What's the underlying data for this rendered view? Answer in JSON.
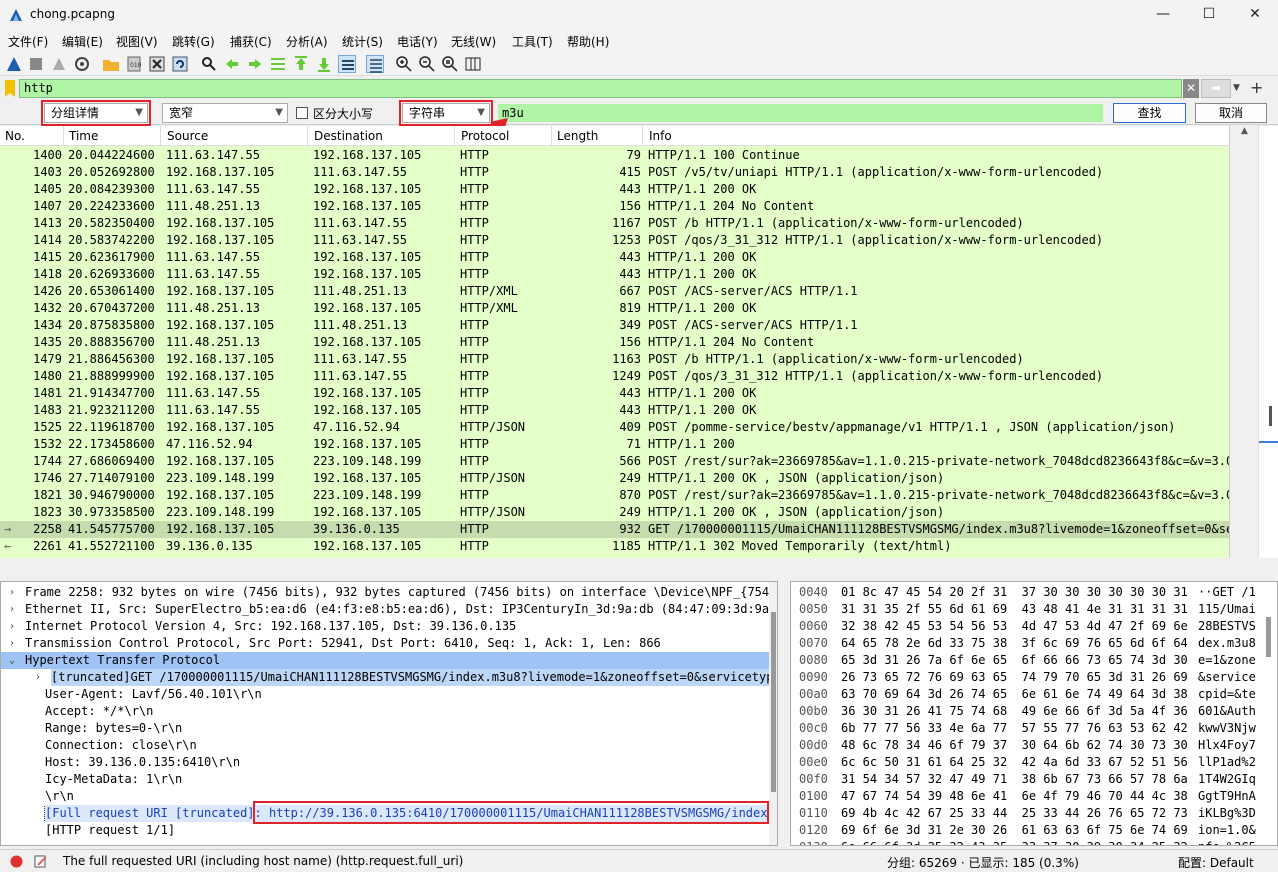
{
  "window": {
    "title": "chong.pcapng"
  },
  "menu": [
    "文件(F)",
    "编辑(E)",
    "视图(V)",
    "跳转(G)",
    "捕获(C)",
    "分析(A)",
    "统计(S)",
    "电话(Y)",
    "无线(W)",
    "工具(T)",
    "帮助(H)"
  ],
  "filter": {
    "value": "http"
  },
  "find": {
    "search_in": "分组详情",
    "charset": "宽窄",
    "case_label": "区分大小写",
    "search_type": "字符串",
    "search_value": "m3u",
    "find_button": "查找",
    "cancel_button": "取消"
  },
  "columns": [
    "No.",
    "Time",
    "Source",
    "Destination",
    "Protocol",
    "Length",
    "Info"
  ],
  "packets": [
    {
      "no": "1400",
      "time": "20.044224600",
      "src": "111.63.147.55",
      "dst": "192.168.137.105",
      "proto": "HTTP",
      "len": "79",
      "info": "HTTP/1.1 100 Continue"
    },
    {
      "no": "1403",
      "time": "20.052692800",
      "src": "192.168.137.105",
      "dst": "111.63.147.55",
      "proto": "HTTP",
      "len": "415",
      "info": "POST /v5/tv/uniapi HTTP/1.1  (application/x-www-form-urlencoded)"
    },
    {
      "no": "1405",
      "time": "20.084239300",
      "src": "111.63.147.55",
      "dst": "192.168.137.105",
      "proto": "HTTP",
      "len": "443",
      "info": "HTTP/1.1 200 OK"
    },
    {
      "no": "1407",
      "time": "20.224233600",
      "src": "111.48.251.13",
      "dst": "192.168.137.105",
      "proto": "HTTP",
      "len": "156",
      "info": "HTTP/1.1 204 No Content"
    },
    {
      "no": "1413",
      "time": "20.582350400",
      "src": "192.168.137.105",
      "dst": "111.63.147.55",
      "proto": "HTTP",
      "len": "1167",
      "info": "POST /b HTTP/1.1  (application/x-www-form-urlencoded)"
    },
    {
      "no": "1414",
      "time": "20.583742200",
      "src": "192.168.137.105",
      "dst": "111.63.147.55",
      "proto": "HTTP",
      "len": "1253",
      "info": "POST /qos/3_31_312 HTTP/1.1  (application/x-www-form-urlencoded)"
    },
    {
      "no": "1415",
      "time": "20.623617900",
      "src": "111.63.147.55",
      "dst": "192.168.137.105",
      "proto": "HTTP",
      "len": "443",
      "info": "HTTP/1.1 200 OK"
    },
    {
      "no": "1418",
      "time": "20.626933600",
      "src": "111.63.147.55",
      "dst": "192.168.137.105",
      "proto": "HTTP",
      "len": "443",
      "info": "HTTP/1.1 200 OK"
    },
    {
      "no": "1426",
      "time": "20.653061400",
      "src": "192.168.137.105",
      "dst": "111.48.251.13",
      "proto": "HTTP/XML",
      "len": "667",
      "info": "POST /ACS-server/ACS HTTP/1.1"
    },
    {
      "no": "1432",
      "time": "20.670437200",
      "src": "111.48.251.13",
      "dst": "192.168.137.105",
      "proto": "HTTP/XML",
      "len": "819",
      "info": "HTTP/1.1 200 OK"
    },
    {
      "no": "1434",
      "time": "20.875835800",
      "src": "192.168.137.105",
      "dst": "111.48.251.13",
      "proto": "HTTP",
      "len": "349",
      "info": "POST /ACS-server/ACS HTTP/1.1"
    },
    {
      "no": "1435",
      "time": "20.888356700",
      "src": "111.48.251.13",
      "dst": "192.168.137.105",
      "proto": "HTTP",
      "len": "156",
      "info": "HTTP/1.1 204 No Content"
    },
    {
      "no": "1479",
      "time": "21.886456300",
      "src": "192.168.137.105",
      "dst": "111.63.147.55",
      "proto": "HTTP",
      "len": "1163",
      "info": "POST /b HTTP/1.1  (application/x-www-form-urlencoded)"
    },
    {
      "no": "1480",
      "time": "21.888999900",
      "src": "192.168.137.105",
      "dst": "111.63.147.55",
      "proto": "HTTP",
      "len": "1249",
      "info": "POST /qos/3_31_312 HTTP/1.1  (application/x-www-form-urlencoded)"
    },
    {
      "no": "1481",
      "time": "21.914347700",
      "src": "111.63.147.55",
      "dst": "192.168.137.105",
      "proto": "HTTP",
      "len": "443",
      "info": "HTTP/1.1 200 OK"
    },
    {
      "no": "1483",
      "time": "21.923211200",
      "src": "111.63.147.55",
      "dst": "192.168.137.105",
      "proto": "HTTP",
      "len": "443",
      "info": "HTTP/1.1 200 OK"
    },
    {
      "no": "1525",
      "time": "22.119618700",
      "src": "192.168.137.105",
      "dst": "47.116.52.94",
      "proto": "HTTP/JSON",
      "len": "409",
      "info": "POST /pomme-service/bestv/appmanage/v1 HTTP/1.1 , JSON (application/json)"
    },
    {
      "no": "1532",
      "time": "22.173458600",
      "src": "47.116.52.94",
      "dst": "192.168.137.105",
      "proto": "HTTP",
      "len": "71",
      "info": "HTTP/1.1 200"
    },
    {
      "no": "1744",
      "time": "27.686069400",
      "src": "192.168.137.105",
      "dst": "223.109.148.199",
      "proto": "HTTP",
      "len": "566",
      "info": "POST /rest/sur?ak=23669785&av=1.1.0.215-private-network_7048dcd8236643f8&c=&v=3.0&s"
    },
    {
      "no": "1746",
      "time": "27.714079100",
      "src": "223.109.148.199",
      "dst": "192.168.137.105",
      "proto": "HTTP/JSON",
      "len": "249",
      "info": "HTTP/1.1 200 OK , JSON (application/json)"
    },
    {
      "no": "1821",
      "time": "30.946790000",
      "src": "192.168.137.105",
      "dst": "223.109.148.199",
      "proto": "HTTP",
      "len": "870",
      "info": "POST /rest/sur?ak=23669785&av=1.1.0.215-private-network_7048dcd8236643f8&c=&v=3.0&s"
    },
    {
      "no": "1823",
      "time": "30.973358500",
      "src": "223.109.148.199",
      "dst": "192.168.137.105",
      "proto": "HTTP/JSON",
      "len": "249",
      "info": "HTTP/1.1 200 OK , JSON (application/json)"
    },
    {
      "no": "2258",
      "time": "41.545775700",
      "src": "192.168.137.105",
      "dst": "39.136.0.135",
      "proto": "HTTP",
      "len": "932",
      "info": "GET /170000001115/UmaiCHAN111128BESTVSMGSMG/index.m3u8?livemode=1&zoneoffset=0&serv",
      "selected": true
    },
    {
      "no": "2261",
      "time": "41.552721100",
      "src": "39.136.0.135",
      "dst": "192.168.137.105",
      "proto": "HTTP",
      "len": "1185",
      "info": "HTTP/1.1 302 Moved Temporarily  (text/html)"
    }
  ],
  "details": [
    {
      "text": "Frame 2258: 932 bytes on wire (7456 bits), 932 bytes captured (7456 bits) on interface \\Device\\NPF_{754BC6",
      "tri": "›"
    },
    {
      "text": "Ethernet II, Src: SuperElectro_b5:ea:d6 (e4:f3:e8:b5:ea:d6), Dst: IP3CenturyIn_3d:9a:db (84:47:09:3d:9a:db",
      "tri": "›"
    },
    {
      "text": "Internet Protocol Version 4, Src: 192.168.137.105, Dst: 39.136.0.135",
      "tri": "›"
    },
    {
      "text": "Transmission Control Protocol, Src Port: 52941, Dst Port: 6410, Seq: 1, Ack: 1, Len: 866",
      "tri": "›"
    },
    {
      "text": "Hypertext Transfer Protocol",
      "tri": "⌄"
    },
    {
      "text": "[truncated]GET /170000001115/UmaiCHAN111128BESTVSMGSMG/index.m3u8?livemode=1&zoneoffset=0&servicetype=1",
      "tri": "›"
    },
    {
      "text": "User-Agent: Lavf/56.40.101\\r\\n",
      "tri": ""
    },
    {
      "text": "Accept: */*\\r\\n",
      "tri": ""
    },
    {
      "text": "Range: bytes=0-\\r\\n",
      "tri": ""
    },
    {
      "text": "Connection: close\\r\\n",
      "tri": ""
    },
    {
      "text": "Host: 39.136.0.135:6410\\r\\n",
      "tri": ""
    },
    {
      "text": "Icy-MetaData: 1\\r\\n",
      "tri": ""
    },
    {
      "text": "\\r\\n",
      "tri": ""
    },
    {
      "text": "[Full request URI [truncated]: http://39.136.0.135:6410/170000001115/UmaiCHAN111128BESTVSMGSMG/index.m3u8",
      "tri": ""
    },
    {
      "text": "[HTTP request 1/1]",
      "tri": ""
    }
  ],
  "hex": [
    {
      "off": "0040",
      "bytes": "01 8c 47 45 54 20 2f 31  37 30 30 30 30 30 30 31",
      "ascii": "··GET /1"
    },
    {
      "off": "0050",
      "bytes": "31 31 35 2f 55 6d 61 69  43 48 41 4e 31 31 31 31",
      "ascii": "115/Umai"
    },
    {
      "off": "0060",
      "bytes": "32 38 42 45 53 54 56 53  4d 47 53 4d 47 2f 69 6e",
      "ascii": "28BESTVS"
    },
    {
      "off": "0070",
      "bytes": "64 65 78 2e 6d 33 75 38  3f 6c 69 76 65 6d 6f 64",
      "ascii": "dex.m3u8"
    },
    {
      "off": "0080",
      "bytes": "65 3d 31 26 7a 6f 6e 65  6f 66 66 73 65 74 3d 30",
      "ascii": "e=1&zone"
    },
    {
      "off": "0090",
      "bytes": "26 73 65 72 76 69 63 65  74 79 70 65 3d 31 26 69",
      "ascii": "&service"
    },
    {
      "off": "00a0",
      "bytes": "63 70 69 64 3d 26 74 65  6e 61 6e 74 49 64 3d 38",
      "ascii": "cpid=&te"
    },
    {
      "off": "00b0",
      "bytes": "36 30 31 26 41 75 74 68  49 6e 66 6f 3d 5a 4f 36",
      "ascii": "601&Auth"
    },
    {
      "off": "00c0",
      "bytes": "6b 77 77 56 33 4e 6a 77  57 55 77 76 63 53 62 42",
      "ascii": "kwwV3Njw"
    },
    {
      "off": "00d0",
      "bytes": "48 6c 78 34 46 6f 79 37  30 64 6b 62 74 30 73 30",
      "ascii": "Hlx4Foy7"
    },
    {
      "off": "00e0",
      "bytes": "6c 6c 50 31 61 64 25 32  42 4a 6d 33 67 52 51 56",
      "ascii": "llP1ad%2"
    },
    {
      "off": "00f0",
      "bytes": "31 54 34 57 32 47 49 71  38 6b 67 73 66 57 78 6a",
      "ascii": "1T4W2GIq"
    },
    {
      "off": "0100",
      "bytes": "47 67 74 54 39 48 6e 41  6e 4f 79 46 70 44 4c 38",
      "ascii": "GgtT9HnA"
    },
    {
      "off": "0110",
      "bytes": "69 4b 4c 42 67 25 33 44  25 33 44 26 76 65 72 73",
      "ascii": "iKLBg%3D"
    },
    {
      "off": "0120",
      "bytes": "69 6f 6e 3d 31 2e 30 26  61 63 63 6f 75 6e 74 69",
      "ascii": "ion=1.0&"
    },
    {
      "off": "0130",
      "bytes": "6e 66 6f 3d 25 32 43 35  33 37 30 39 30 34 25 32",
      "ascii": "nfo=%2C5"
    },
    {
      "off": "0140",
      "bytes": "43 31 31 31 2e 34 37 2e  32 34 35 2e 38 32 25 32",
      "ascii": "C111.47."
    }
  ],
  "status": {
    "message": "The full requested URI (including host name) (http.request.full_uri)",
    "packets": "分组: 65269 · 已显示: 185 (0.3%)",
    "profile": "配置: Default"
  },
  "colors": {
    "filter_bg": "#aff5a5",
    "list_bg": "#e4ffc7",
    "selected_row": "#c6dbae",
    "highlight": "#9fc3f5",
    "annotation_red": "#e0222a"
  }
}
